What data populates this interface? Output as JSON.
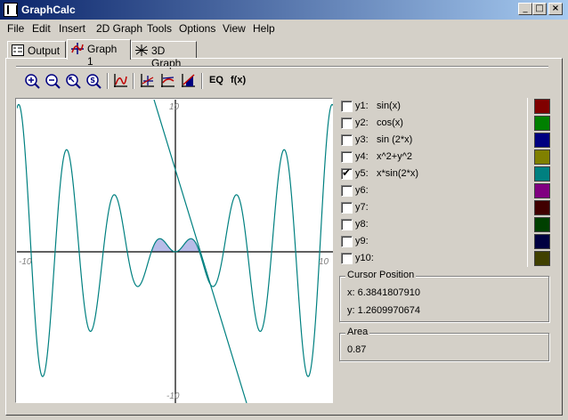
{
  "window": {
    "title": "GraphCalc",
    "min": "_",
    "max": "□",
    "close": "×"
  },
  "menu": [
    "File",
    "Edit",
    "Insert",
    "2D Graph",
    "Tools",
    "Options",
    "View",
    "Help"
  ],
  "tabs": [
    {
      "label": "Output",
      "icon": "output-icon"
    },
    {
      "label": "Graph 1",
      "icon": "graph-2d-icon",
      "active": true
    },
    {
      "label": "3D Graph",
      "icon": "graph-3d-icon"
    }
  ],
  "toolbar": {
    "icons": [
      "zoom-in-icon",
      "zoom-out-icon",
      "zoom-box-icon",
      "zoom-standard-icon",
      "graph-settings-icon",
      "trace-icon",
      "tangent-icon",
      "area-icon"
    ],
    "eq_label": "EQ",
    "fx_label": "f(x)"
  },
  "graph": {
    "axis_labels": {
      "ymax": "10",
      "ymin": "-10",
      "xmin": "-10",
      "xmax": "10"
    }
  },
  "functions": [
    {
      "label": "y1:",
      "expr": "sin(x)",
      "checked": false,
      "color": "#800000"
    },
    {
      "label": "y2:",
      "expr": "cos(x)",
      "checked": false,
      "color": "#008000"
    },
    {
      "label": "y3:",
      "expr": "sin (2*x)",
      "checked": false,
      "color": "#000080"
    },
    {
      "label": "y4:",
      "expr": "x^2+y^2",
      "checked": false,
      "color": "#808000"
    },
    {
      "label": "y5:",
      "expr": "x*sin(2*x)",
      "checked": true,
      "color": "#008080"
    },
    {
      "label": "y6:",
      "expr": "",
      "checked": false,
      "color": "#800080"
    },
    {
      "label": "y7:",
      "expr": "",
      "checked": false,
      "color": "#400000"
    },
    {
      "label": "y8:",
      "expr": "",
      "checked": false,
      "color": "#004000"
    },
    {
      "label": "y9:",
      "expr": "",
      "checked": false,
      "color": "#000040"
    },
    {
      "label": "y10:",
      "expr": "",
      "checked": false,
      "color": "#404000"
    }
  ],
  "cursor": {
    "title": "Cursor Position",
    "x": "x: 6.3841807910",
    "y": "y: 1.2609970674"
  },
  "area": {
    "title": "Area",
    "value": "0.87"
  }
}
